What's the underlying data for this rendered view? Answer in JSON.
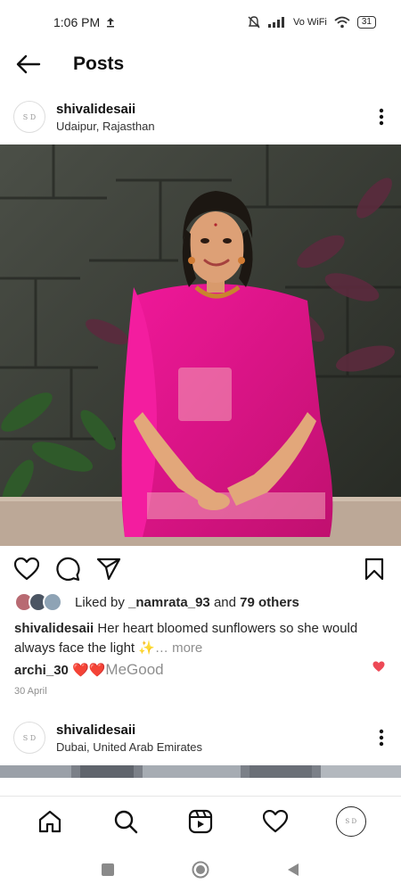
{
  "status_bar": {
    "time": "1:06 PM",
    "network": "Vo WiFi",
    "battery": "31"
  },
  "header": {
    "title": "Posts"
  },
  "posts": [
    {
      "avatar_text": "S D",
      "username": "shivalidesaii",
      "location": "Udaipur, Rajasthan"
    },
    {
      "avatar_text": "S D",
      "username": "shivalidesaii",
      "location": "Dubai, United Arab Emirates"
    }
  ],
  "likes": {
    "prefix": "Liked by",
    "user": "_namrata_93",
    "and": "and",
    "others": "79 others"
  },
  "caption": {
    "username": "shivalidesaii",
    "text": "Her heart bloomed sunflowers so she would always face the light ✨",
    "more": "… more"
  },
  "comment": {
    "username": "archi_30",
    "text": "❤️❤️"
  },
  "overlay_text": "MeGood",
  "date": "30 April",
  "icons": {
    "back": "arrow-left-icon",
    "more": "more-vertical-icon",
    "like": "heart-outline-icon",
    "comment": "comment-icon",
    "share": "send-icon",
    "save": "bookmark-icon",
    "home": "home-icon",
    "search": "search-icon",
    "reels": "reels-icon",
    "activity": "heart-icon"
  },
  "colors": {
    "accent_like": "#ed4956",
    "text": "#262626",
    "muted": "#8e8e8e",
    "saree": "#e0148c"
  }
}
